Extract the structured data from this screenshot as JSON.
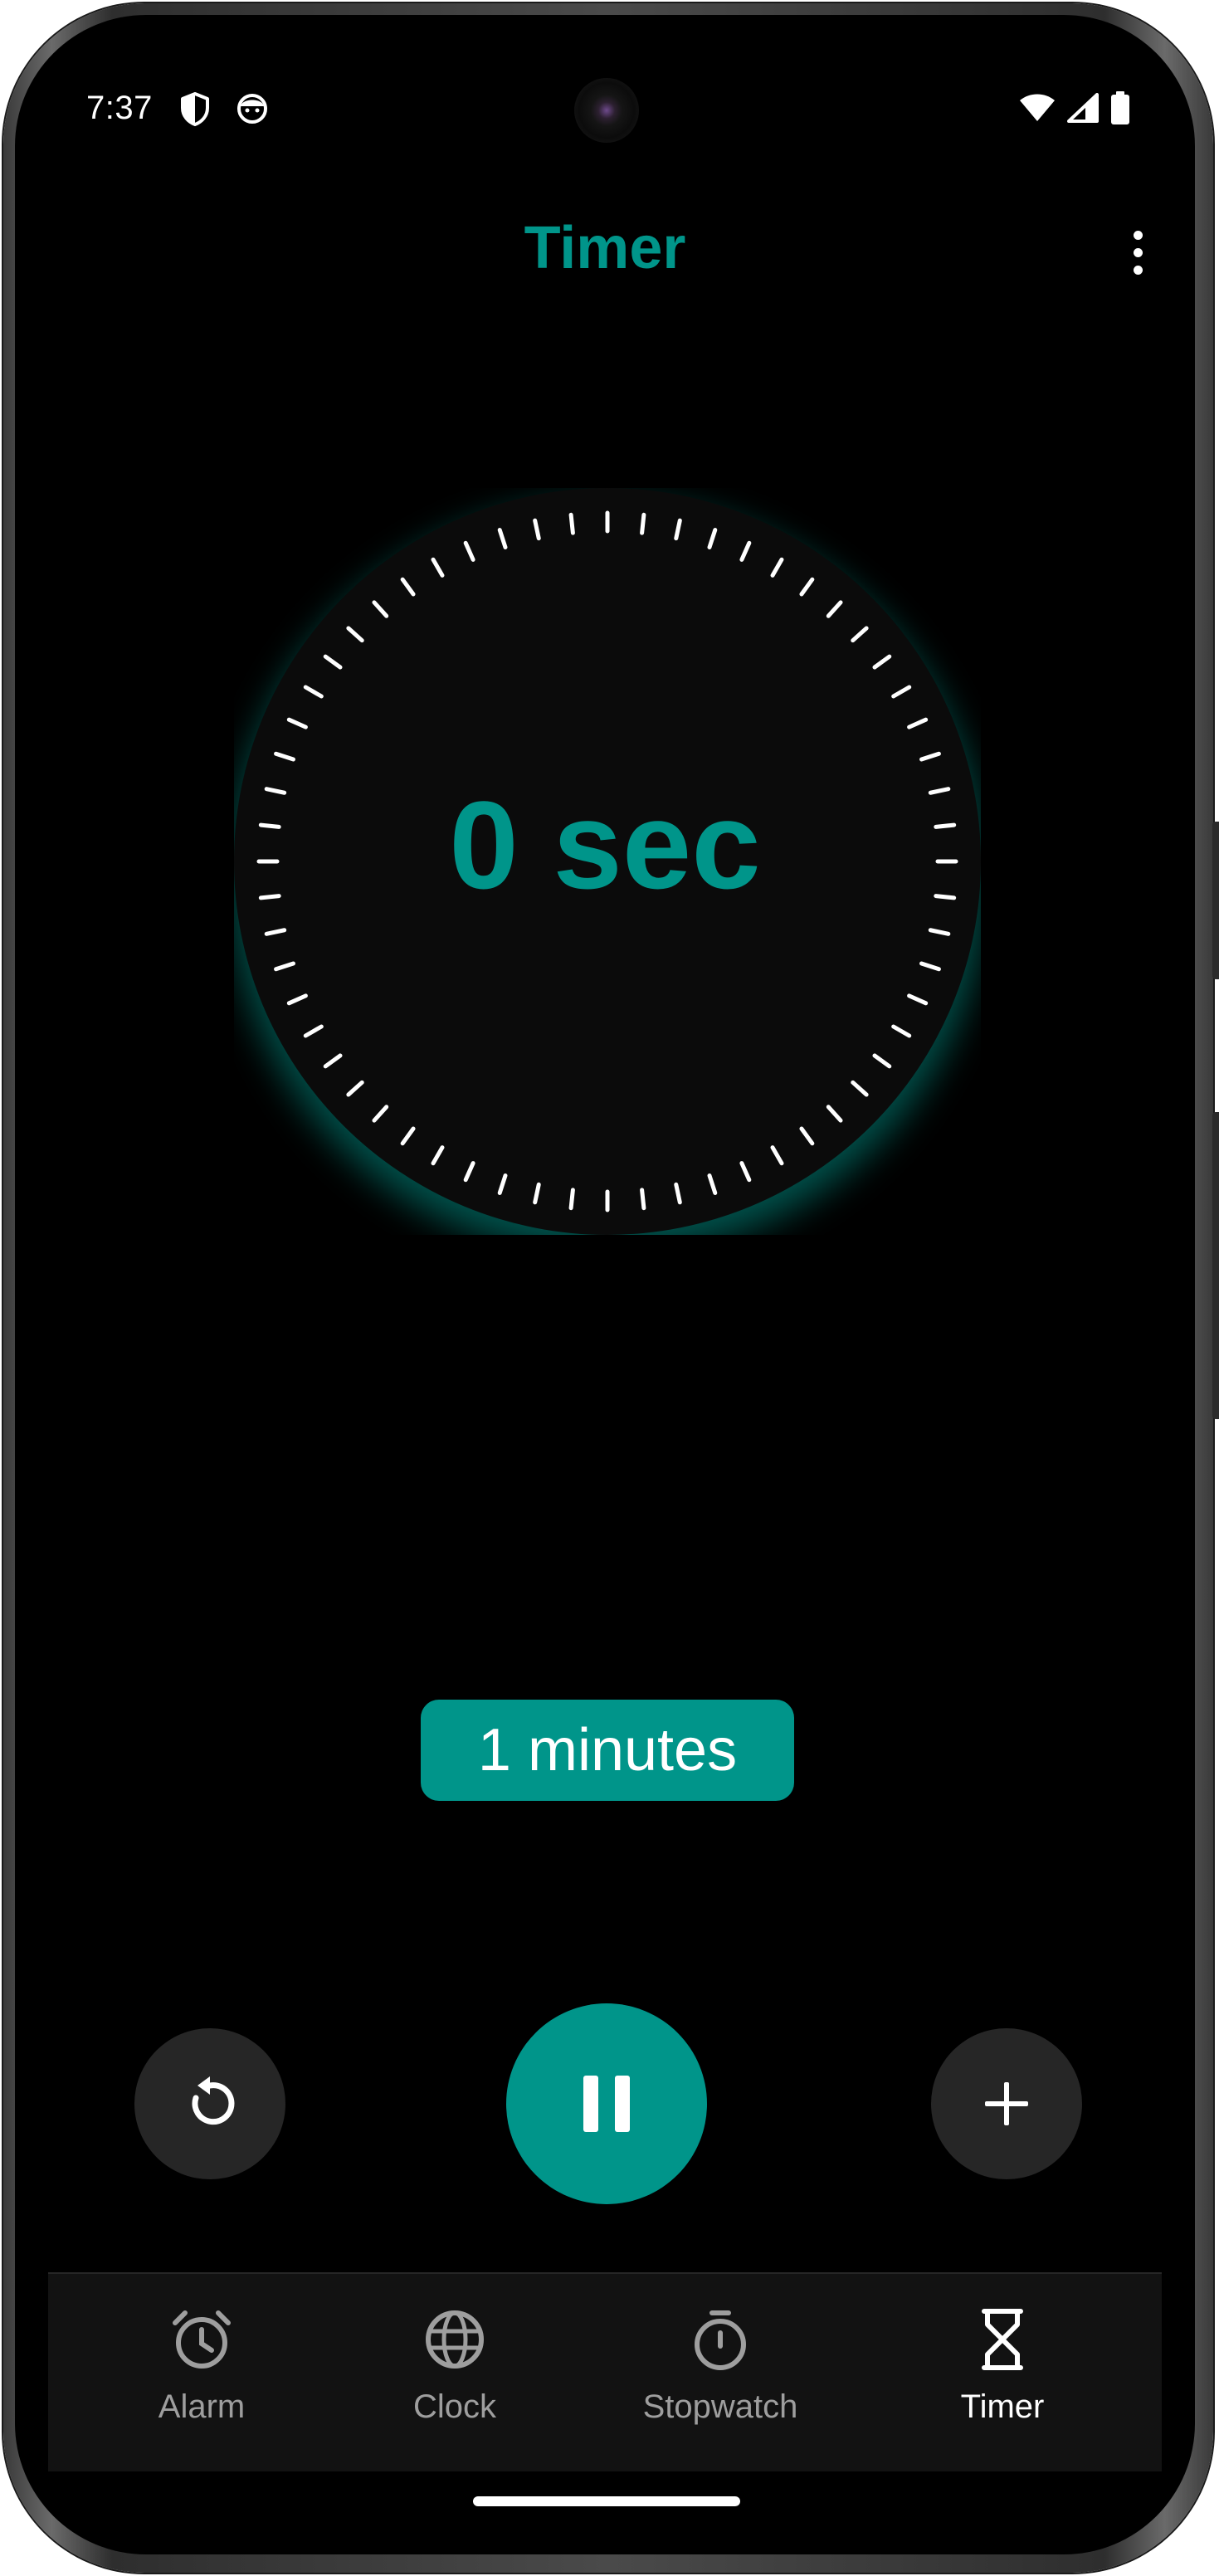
{
  "status_bar": {
    "time": "7:37",
    "left_icons": [
      "shield-icon",
      "face-icon"
    ],
    "right_icons": [
      "wifi-icon",
      "cell-signal-icon",
      "battery-icon"
    ]
  },
  "app_bar": {
    "title": "Timer",
    "menu_icon": "more-vert-icon"
  },
  "timer": {
    "display": "0 sec",
    "preset_chip": "1 minutes"
  },
  "controls": {
    "reset_icon": "reset-icon",
    "play_pause_icon": "pause-icon",
    "add_icon": "plus-icon"
  },
  "bottom_nav": {
    "items": [
      {
        "label": "Alarm",
        "icon": "alarm-clock-icon",
        "active": false
      },
      {
        "label": "Clock",
        "icon": "globe-icon",
        "active": false
      },
      {
        "label": "Stopwatch",
        "icon": "stopwatch-icon",
        "active": false
      },
      {
        "label": "Timer",
        "icon": "hourglass-icon",
        "active": true
      }
    ]
  },
  "colors": {
    "accent": "#00958a",
    "background": "#000000",
    "surface": "#262626",
    "nav_background": "#121212",
    "inactive": "#9e9e9e"
  }
}
